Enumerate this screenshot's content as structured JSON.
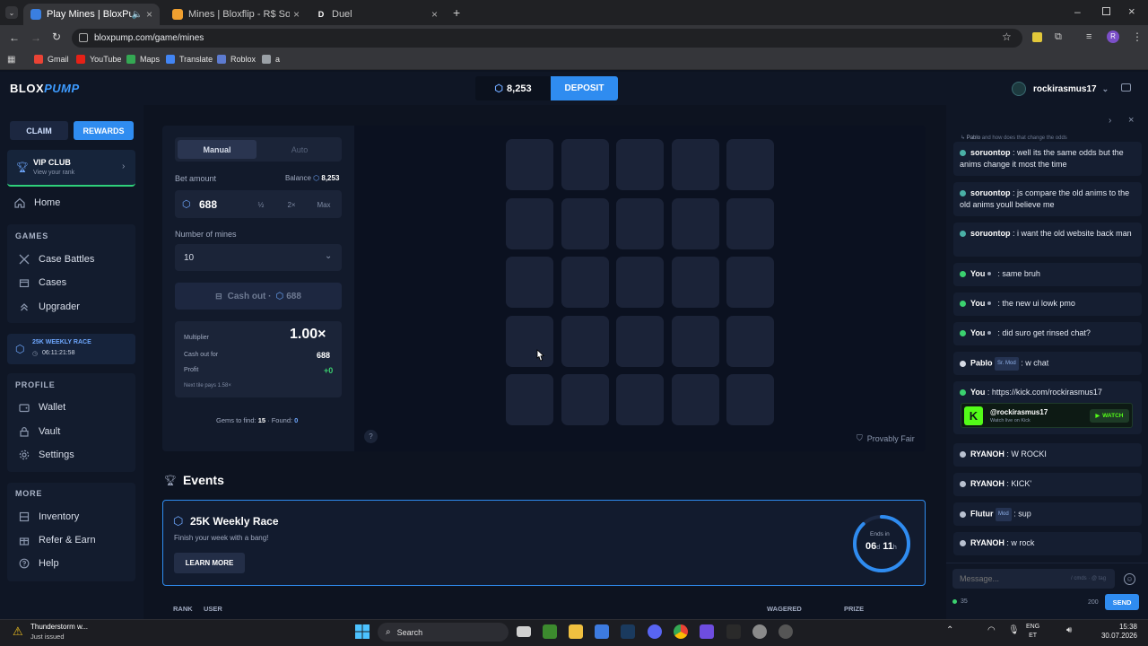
{
  "browser": {
    "tabs": [
      {
        "label": "Play Mines | BloxPump"
      },
      {
        "label": "Mines | Bloxflip - R$ Social Casi"
      },
      {
        "label": "Duel"
      }
    ],
    "url": "bloxpump.com/game/mines",
    "profile_letter": "R",
    "bookmarks": [
      "Gmail",
      "YouTube",
      "Maps",
      "Translate",
      "Roblox",
      "a"
    ]
  },
  "header": {
    "logo_a": "BLOX",
    "logo_b": "PUMP",
    "balance": "8,253",
    "deposit_label": "DEPOSIT",
    "username": "rockirasmus17"
  },
  "sidebar": {
    "claim_label": "CLAIM",
    "rewards_label": "REWARDS",
    "vip_title": "VIP CLUB",
    "vip_sub": "View your rank",
    "home": "Home",
    "games_heading": "GAMES",
    "games": [
      "Case Battles",
      "Cases",
      "Upgrader"
    ],
    "race_title": "25K WEEKLY RACE",
    "race_timer": "06:11:21:58",
    "profile_heading": "PROFILE",
    "profile": [
      "Wallet",
      "Vault",
      "Settings"
    ],
    "more_heading": "MORE",
    "more": [
      "Inventory",
      "Refer & Earn",
      "Help"
    ]
  },
  "game": {
    "mode_manual": "Manual",
    "mode_auto": "Auto",
    "bet_label": "Bet amount",
    "balance_label": "Balance",
    "balance_value": "8,253",
    "bet_value": "688",
    "half_label": "½",
    "double_label": "2×",
    "max_label": "Max",
    "mines_label": "Number of mines",
    "mines_value": "10",
    "cashout_label": "Cash out ·",
    "cashout_value": "688",
    "multiplier_label": "Multiplier",
    "multiplier_value": "1.00×",
    "cashout_for_label": "Cash out for",
    "cashout_for_value": "688",
    "profit_label": "Profit",
    "profit_value": "+0",
    "next_tile": "Next tile pays 1.58×",
    "gems_label": "Gems to find:",
    "gems_value": "15",
    "found_label": "· Found:",
    "found_value": "0",
    "help_label": "?",
    "provably_fair": "Provably Fair",
    "grid_rows": 5,
    "grid_cols": 5
  },
  "events": {
    "heading": "Events",
    "race_title": "25K Weekly Race",
    "race_sub": "Finish your week with a bang!",
    "learn_more": "LEARN MORE",
    "ends_label": "Ends in",
    "ends_d": "06",
    "ends_d_unit": "d",
    "ends_h": "11",
    "ends_h_unit": "h",
    "ring_fraction": 0.88,
    "col_rank": "RANK",
    "col_user": "USER",
    "col_wagered": "WAGERED",
    "col_prize": "PRIZE"
  },
  "chat": {
    "reply_user": "Pablo",
    "reply_text": "and how does that change the odds",
    "messages": [
      {
        "user": "soruontop",
        "text": ": well its the same odds but the anims change it most the time"
      },
      {
        "user": "soruontop",
        "text": ": js compare the old anims to the old anims youll believe me"
      },
      {
        "user": "soruontop",
        "text": ": i want the old website back man"
      },
      {
        "user": "You",
        "text": ": same bruh"
      },
      {
        "user": "You",
        "text": ": the new ui lowk pmo"
      },
      {
        "user": "You",
        "text": ": did suro get rinsed chat?"
      },
      {
        "user": "Pablo",
        "badge": "Sr. Mod",
        "text": ": w chat"
      },
      {
        "user": "You",
        "text": ": https://kick.com/rockirasmus17"
      },
      {
        "user": "RYANOH",
        "text": ": W ROCKI"
      },
      {
        "user": "RYANOH",
        "text": ": KICK'"
      },
      {
        "user": "Flutur",
        "badge": "Mod",
        "text": ": sup"
      },
      {
        "user": "RYANOH",
        "text": ": w rock"
      }
    ],
    "kick_handle": "@rockirasmus17",
    "kick_sub": "Watch live on Kick",
    "kick_watch": "WATCH",
    "kick_letter": "K",
    "input_placeholder": "Message...",
    "input_hint": "/ cmds · @ tag",
    "online_count": "35",
    "char_limit": "200",
    "send_label": "SEND"
  },
  "taskbar": {
    "weather_title": "Thunderstorm w...",
    "weather_sub": "Just issued",
    "search_label": "Search",
    "lang_a": "ENG",
    "lang_b": "ET",
    "time": "15:38",
    "date": "30.07.2026"
  }
}
